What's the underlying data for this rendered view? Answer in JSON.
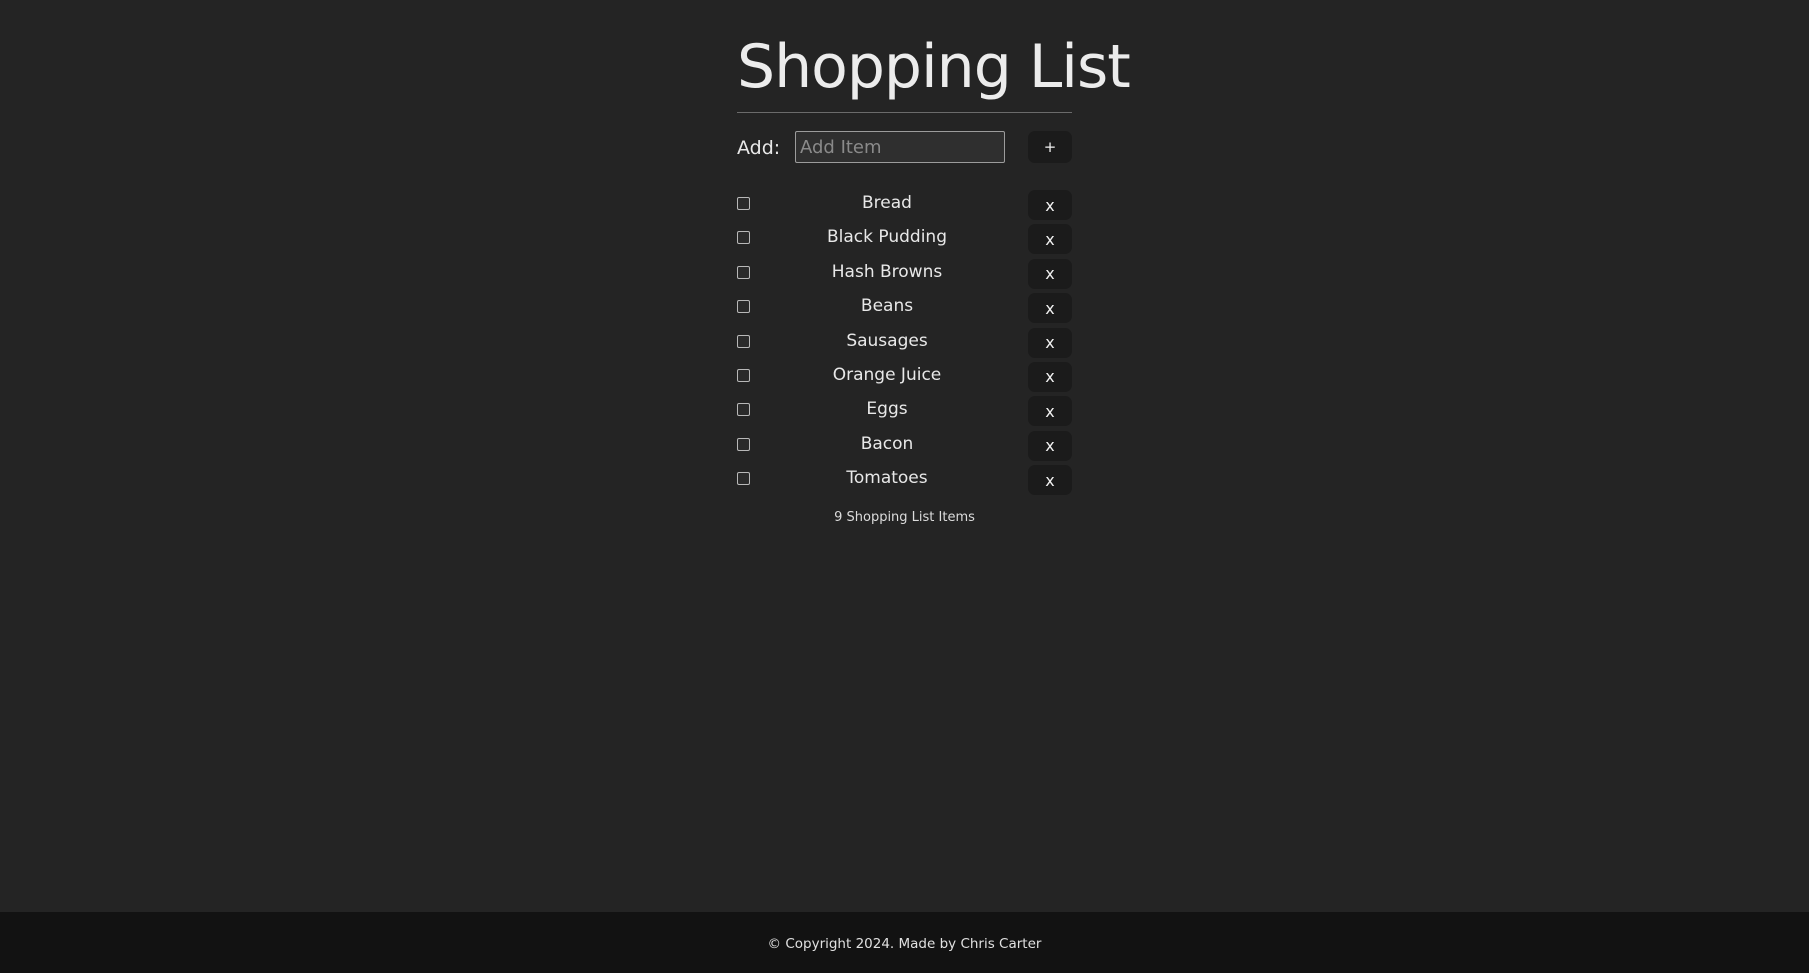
{
  "header": {
    "title": "Shopping List"
  },
  "add_form": {
    "label": "Add:",
    "input_value": "",
    "input_placeholder": "Add Item",
    "add_button_label": "+"
  },
  "list": {
    "items": [
      {
        "label": "Bread",
        "checked": false,
        "remove_label": "x"
      },
      {
        "label": "Black Pudding",
        "checked": false,
        "remove_label": "x"
      },
      {
        "label": "Hash Browns",
        "checked": false,
        "remove_label": "x"
      },
      {
        "label": "Beans",
        "checked": false,
        "remove_label": "x"
      },
      {
        "label": "Sausages",
        "checked": false,
        "remove_label": "x"
      },
      {
        "label": "Orange Juice",
        "checked": false,
        "remove_label": "x"
      },
      {
        "label": "Eggs",
        "checked": false,
        "remove_label": "x"
      },
      {
        "label": "Bacon",
        "checked": false,
        "remove_label": "x"
      },
      {
        "label": "Tomatoes",
        "checked": false,
        "remove_label": "x"
      }
    ],
    "count_text": "9 Shopping List Items"
  },
  "footer": {
    "text": "© Copyright 2024. Made by Chris Carter"
  },
  "colors": {
    "background": "#242424",
    "footer_background": "#121212",
    "button_background": "#1b1b1b",
    "text": "#e6e6e6"
  }
}
